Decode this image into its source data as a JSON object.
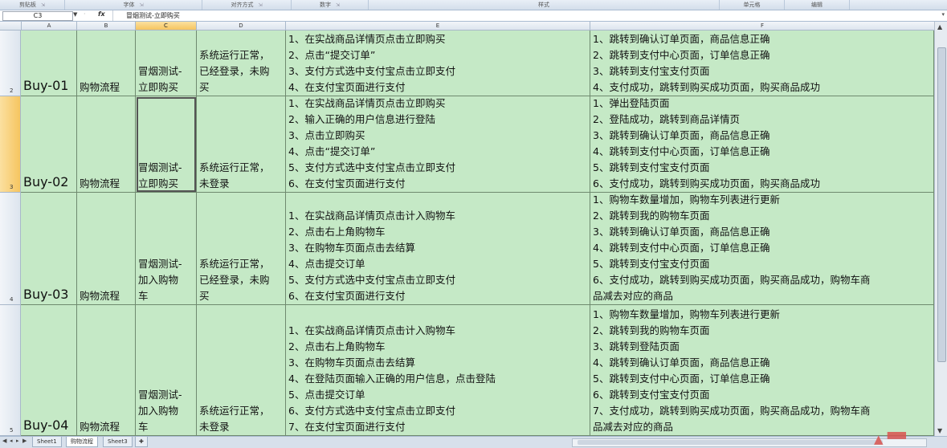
{
  "ribbon": {
    "groups": [
      "剪贴板",
      "字体",
      "对齐方式",
      "数字",
      "样式",
      "单元格",
      "编辑"
    ]
  },
  "formula_bar": {
    "name_box": "C3",
    "formula": "冒烟测试-立即购买"
  },
  "columns": [
    "A",
    "B",
    "C",
    "D",
    "E",
    "F"
  ],
  "active_column": "C",
  "rows": [
    {
      "number": "2",
      "id": "Buy-01",
      "module": "购物流程",
      "title": [
        "冒烟测试-",
        "立即购买"
      ],
      "precondition": [
        "系统运行正常，",
        "已经登录，未购",
        "买"
      ],
      "steps": [
        "1、在实战商品详情页点击立即购买",
        "2、点击“提交订单”",
        "3、支付方式选中支付宝点击立即支付",
        "4、在支付宝页面进行支付"
      ],
      "expected": [
        "1、跳转到确认订单页面，商品信息正确",
        "2、跳转到支付中心页面，订单信息正确",
        "3、跳转到支付宝支付页面",
        "4、支付成功，跳转到购买成功页面，购买商品成功"
      ]
    },
    {
      "number": "3",
      "id": "Buy-02",
      "module": "购物流程",
      "title": [
        "冒烟测试-",
        "立即购买"
      ],
      "precondition": [
        "系统运行正常，",
        "未登录"
      ],
      "steps": [
        "1、在实战商品详情页点击立即购买",
        "2、输入正确的用户信息进行登陆",
        "3、点击立即购买",
        "4、点击“提交订单”",
        "5、支付方式选中支付宝点击立即支付",
        "6、在支付宝页面进行支付"
      ],
      "expected": [
        "1、弹出登陆页面",
        "2、登陆成功，跳转到商品详情页",
        "3、跳转到确认订单页面，商品信息正确",
        "4、跳转到支付中心页面，订单信息正确",
        "5、跳转到支付宝支付页面",
        "6、支付成功，跳转到购买成功页面，购买商品成功"
      ]
    },
    {
      "number": "4",
      "id": "Buy-03",
      "module": "购物流程",
      "title": [
        "冒烟测试-",
        "加入购物",
        "车"
      ],
      "precondition": [
        "系统运行正常，",
        "已经登录，未购",
        "买"
      ],
      "steps": [
        "1、在实战商品详情页点击计入购物车",
        "2、点击右上角购物车",
        "3、在购物车页面点击去结算",
        "4、点击提交订单",
        "5、支付方式选中支付宝点击立即支付",
        "6、在支付宝页面进行支付"
      ],
      "expected": [
        "1、购物车数量增加，购物车列表进行更新",
        "2、跳转到我的购物车页面",
        "3、跳转到确认订单页面，商品信息正确",
        "4、跳转到支付中心页面，订单信息正确",
        "5、跳转到支付宝支付页面",
        "6、支付成功，跳转到购买成功页面，购买商品成功，购物车商",
        "品减去对应的商品"
      ]
    },
    {
      "number": "5",
      "id": "Buy-04",
      "module": "购物流程",
      "title": [
        "冒烟测试-",
        "加入购物",
        "车"
      ],
      "precondition": [
        "系统运行正常，",
        "未登录"
      ],
      "steps": [
        "1、在实战商品详情页点击计入购物车",
        "2、点击右上角购物车",
        "3、在购物车页面点击去结算",
        "4、在登陆页面输入正确的用户信息，点击登陆",
        "5、点击提交订单",
        "6、支付方式选中支付宝点击立即支付",
        "7、在支付宝页面进行支付"
      ],
      "expected": [
        "1、购物车数量增加，购物车列表进行更新",
        "2、跳转到我的购物车页面",
        "3、跳转到登陆页面",
        "4、跳转到确认订单页面，商品信息正确",
        "5、跳转到支付中心页面，订单信息正确",
        "6、跳转到支付宝支付页面",
        "7、支付成功，跳转到购买成功页面，购买商品成功，购物车商",
        "品减去对应的商品"
      ]
    }
  ],
  "sheet_tabs": [
    "Sheet1",
    "购物流程",
    "Sheet3"
  ],
  "active_sheet": "购物流程",
  "colors": {
    "cell_fill": "#c5e9c6",
    "selection_header": "#f6c560"
  }
}
